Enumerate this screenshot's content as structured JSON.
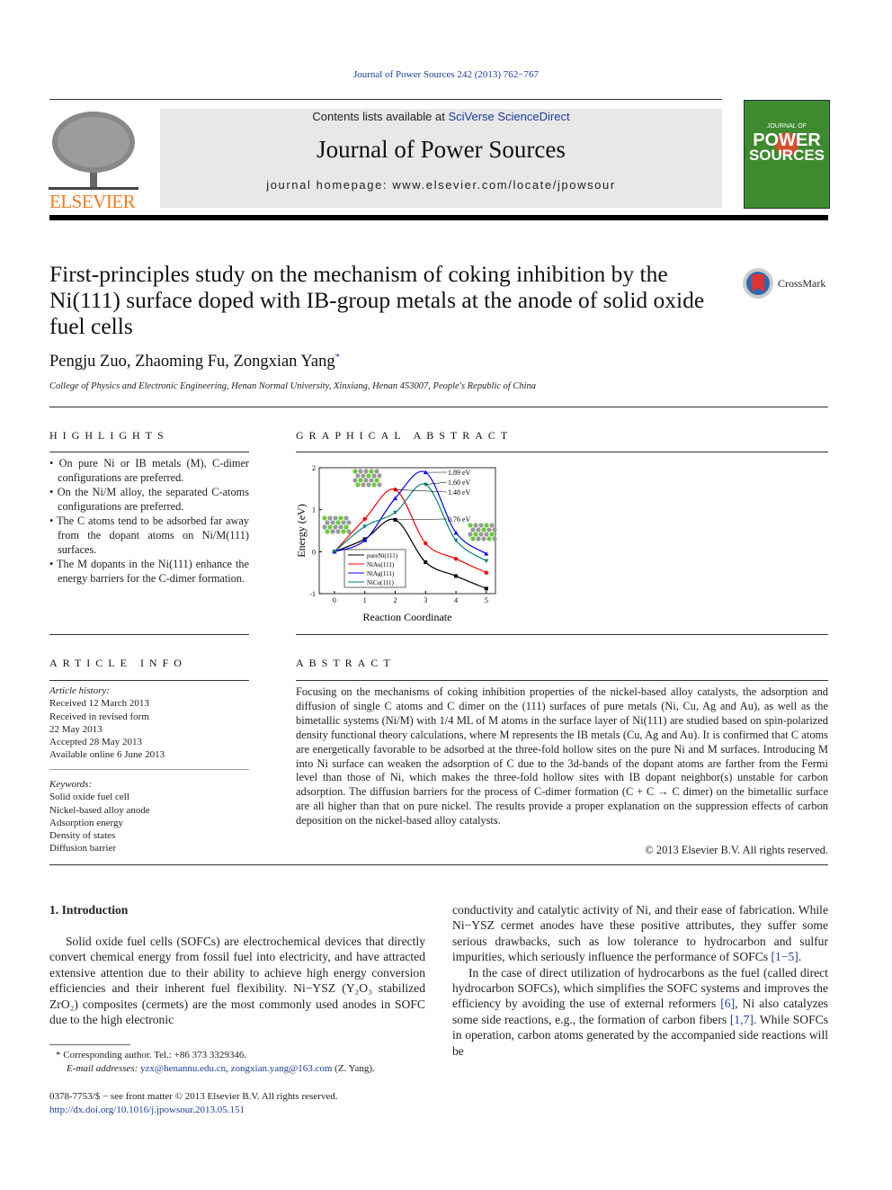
{
  "citation": "Journal of Power Sources 242 (2013) 762−767",
  "masthead": {
    "contents_prefix": "Contents lists available at ",
    "contents_link": "SciVerse ScienceDirect",
    "journal": "Journal of Power Sources",
    "homepage": "journal homepage: www.elsevier.com/locate/jpowsour",
    "publisher": "ELSEVIER",
    "cover_title": "JOURNAL OF POWER SOURCES"
  },
  "article": {
    "title": "First-principles study on the mechanism of coking inhibition by the Ni(111) surface doped with IB-group metals at the anode of solid oxide fuel cells",
    "authors": "Pengju Zuo, Zhaoming Fu, Zongxian Yang",
    "author_mark": "*",
    "affiliation": "College of Physics and Electronic Engineering, Henan Normal University, Xinxiang, Henan 453007, People's Republic of China",
    "crossmark": "CrossMark"
  },
  "highlights": {
    "heading": "HIGHLIGHTS",
    "items": [
      "On pure Ni or IB metals (M), C-dimer configurations are preferred.",
      "On the Ni/M alloy, the separated C-atoms configurations are preferred.",
      "The C atoms tend to be adsorbed far away from the dopant atoms on Ni/M(111) surfaces.",
      "The M dopants in the Ni(111) enhance the energy barriers for the C-dimer formation."
    ]
  },
  "graphical_abstract": {
    "heading": "GRAPHICAL ABSTRACT"
  },
  "chart_data": {
    "type": "line",
    "xlabel": "Reaction Coordinate",
    "ylabel": "Energy (eV)",
    "xlim": [
      -0.5,
      5.3
    ],
    "ylim": [
      -1,
      2
    ],
    "xticks": [
      0,
      1,
      2,
      3,
      4,
      5
    ],
    "yticks": [
      -1,
      0,
      1,
      2
    ],
    "x": [
      0,
      1,
      2,
      3,
      4,
      5
    ],
    "legend_position": "bottom-left",
    "series": [
      {
        "name": "pureNi(111)",
        "color": "#000000",
        "marker": "square",
        "values": [
          0,
          0.3,
          0.76,
          -0.25,
          -0.58,
          -0.88
        ]
      },
      {
        "name": "NiAu(111)",
        "color": "#ff0000",
        "marker": "circle",
        "values": [
          0,
          0.78,
          1.48,
          0.2,
          -0.17,
          -0.5
        ]
      },
      {
        "name": "NiAg(111)",
        "color": "#0000ff",
        "marker": "triangle-up",
        "values": [
          0,
          0.27,
          1.27,
          1.89,
          0.45,
          -0.05
        ]
      },
      {
        "name": "NiCu(111)",
        "color": "#008080",
        "marker": "triangle-down",
        "values": [
          0,
          0.6,
          0.93,
          1.6,
          0.27,
          -0.22
        ]
      }
    ],
    "annotations": [
      "1.89 eV",
      "1.60 eV",
      "1.48 eV",
      "0.76 eV"
    ]
  },
  "article_info": {
    "heading": "ARTICLE INFO",
    "history_label": "Article history:",
    "history": [
      "Received 12 March 2013",
      "Received in revised form",
      "22 May 2013",
      "Accepted 28 May 2013",
      "Available online 6 June 2013"
    ],
    "keywords_label": "Keywords:",
    "keywords": [
      "Solid oxide fuel cell",
      "Nickel-based alloy anode",
      "Adsorption energy",
      "Density of states",
      "Diffusion barrier"
    ]
  },
  "abstract": {
    "heading": "ABSTRACT",
    "text": "Focusing on the mechanisms of coking inhibition properties of the nickel-based alloy catalysts, the adsorption and diffusion of single C atoms and C dimer on the (111) surfaces of pure metals (Ni, Cu, Ag and Au), as well as the bimetallic systems (Ni/M) with 1/4 ML of M atoms in the surface layer of Ni(111) are studied based on spin-polarized density functional theory calculations, where M represents the IB metals (Cu, Ag and Au). It is confirmed that C atoms are energetically favorable to be adsorbed at the three-fold hollow sites on the pure Ni and M surfaces. Introducing M into Ni surface can weaken the adsorption of C due to the 3d-bands of the dopant atoms are farther from the Fermi level than those of Ni, which makes the three-fold hollow sites with IB dopant neighbor(s) unstable for carbon adsorption. The diffusion barriers for the process of C-dimer formation (C + C → C dimer) on the bimetallic surface are all higher than that on pure nickel. The results provide a proper explanation on the suppression effects of carbon deposition on the nickel-based alloy catalysts.",
    "copyright": "© 2013 Elsevier B.V. All rights reserved."
  },
  "intro": {
    "heading": "1.  Introduction",
    "p1": "Solid oxide fuel cells (SOFCs) are electrochemical devices that directly convert chemical energy from fossil fuel into electricity, and have attracted extensive attention due to their ability to achieve high energy conversion efficiencies and their inherent fuel flexibility. Ni−YSZ (Y₂O₃ stabilized ZrO₂) composites (cermets) are the most commonly used anodes in SOFC due to the high electronic",
    "p2": "conductivity and catalytic activity of Ni, and their ease of fabrication. While Ni−YSZ cermet anodes have these positive attributes, they suffer some serious drawbacks, such as low tolerance to hydrocarbon and sulfur impurities, which seriously influence the performance of SOFCs",
    "p2_ref": "[1−5]",
    "p3a": "In the case of direct utilization of hydrocarbons as the fuel (called direct hydrocarbon SOFCs), which simplifies the SOFC systems and improves the efficiency by avoiding the use of external reformers",
    "p3_ref1": "[6]",
    "p3b": ", Ni also catalyzes some side reactions, e.g., the formation of carbon fibers",
    "p3_ref2": "[1,7]",
    "p3c": ". While SOFCs in operation, carbon atoms generated by the accompanied side reactions will be"
  },
  "footnote": {
    "corresponding": "* Corresponding author. Tel.: +86 373 3329346.",
    "email_label": "E-mail addresses:",
    "email1": "yzx@henannu.edu.cn",
    "email2": "zongxian.yang@163.com",
    "email_suffix": " (Z. Yang)."
  },
  "footer": {
    "issn": "0378-7753/$ − see front matter © 2013 Elsevier B.V. All rights reserved.",
    "doi": "http://dx.doi.org/10.1016/j.jpowsour.2013.05.151"
  }
}
